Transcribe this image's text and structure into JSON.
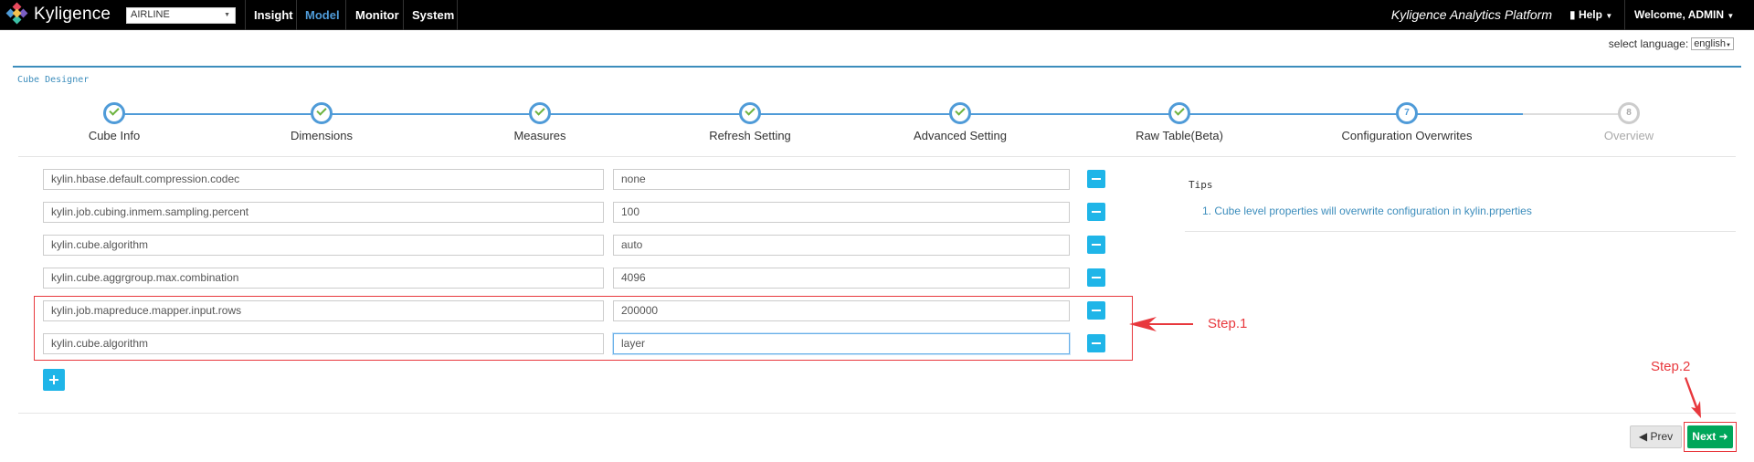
{
  "navbar": {
    "logo_text": "Kyligence",
    "project": "AIRLINE",
    "menu": [
      "Insight",
      "Model",
      "Monitor",
      "System"
    ],
    "active_menu": "Model",
    "platform_title": "Kyligence Analytics Platform",
    "help_label": "Help",
    "welcome_label": "Welcome, ADMIN"
  },
  "language": {
    "label": "select language:",
    "value": "english"
  },
  "panel": {
    "title": "Cube Designer"
  },
  "wizard": {
    "steps": [
      {
        "label": "Cube Info",
        "state": "done"
      },
      {
        "label": "Dimensions",
        "state": "done"
      },
      {
        "label": "Measures",
        "state": "done"
      },
      {
        "label": "Refresh Setting",
        "state": "done"
      },
      {
        "label": "Advanced Setting",
        "state": "done"
      },
      {
        "label": "Raw Table(Beta)",
        "state": "done"
      },
      {
        "label": "Configuration Overwrites",
        "state": "current",
        "number": "7"
      },
      {
        "label": "Overview",
        "state": "disabled",
        "number": "8"
      }
    ]
  },
  "properties": [
    {
      "key": "kylin.hbase.default.compression.codec",
      "value": "none"
    },
    {
      "key": "kylin.job.cubing.inmem.sampling.percent",
      "value": "100"
    },
    {
      "key": "kylin.cube.algorithm",
      "value": "auto"
    },
    {
      "key": "kylin.cube.aggrgroup.max.combination",
      "value": "4096"
    },
    {
      "key": "kylin.job.mapreduce.mapper.input.rows",
      "value": "200000"
    },
    {
      "key": "kylin.cube.algorithm",
      "value": "layer"
    }
  ],
  "tips": {
    "title": "Tips",
    "items": [
      "1. Cube level properties will overwrite configuration in kylin.prperties"
    ]
  },
  "annotations": {
    "step1": "Step.1",
    "step2": "Step.2"
  },
  "footer": {
    "prev_label": "Prev",
    "next_label": "Next"
  },
  "colors": {
    "accent": "#4f9bd8",
    "check": "#6cb33e",
    "action": "#1fb5e8",
    "next": "#00a65a",
    "annotation": "#e8383d"
  }
}
